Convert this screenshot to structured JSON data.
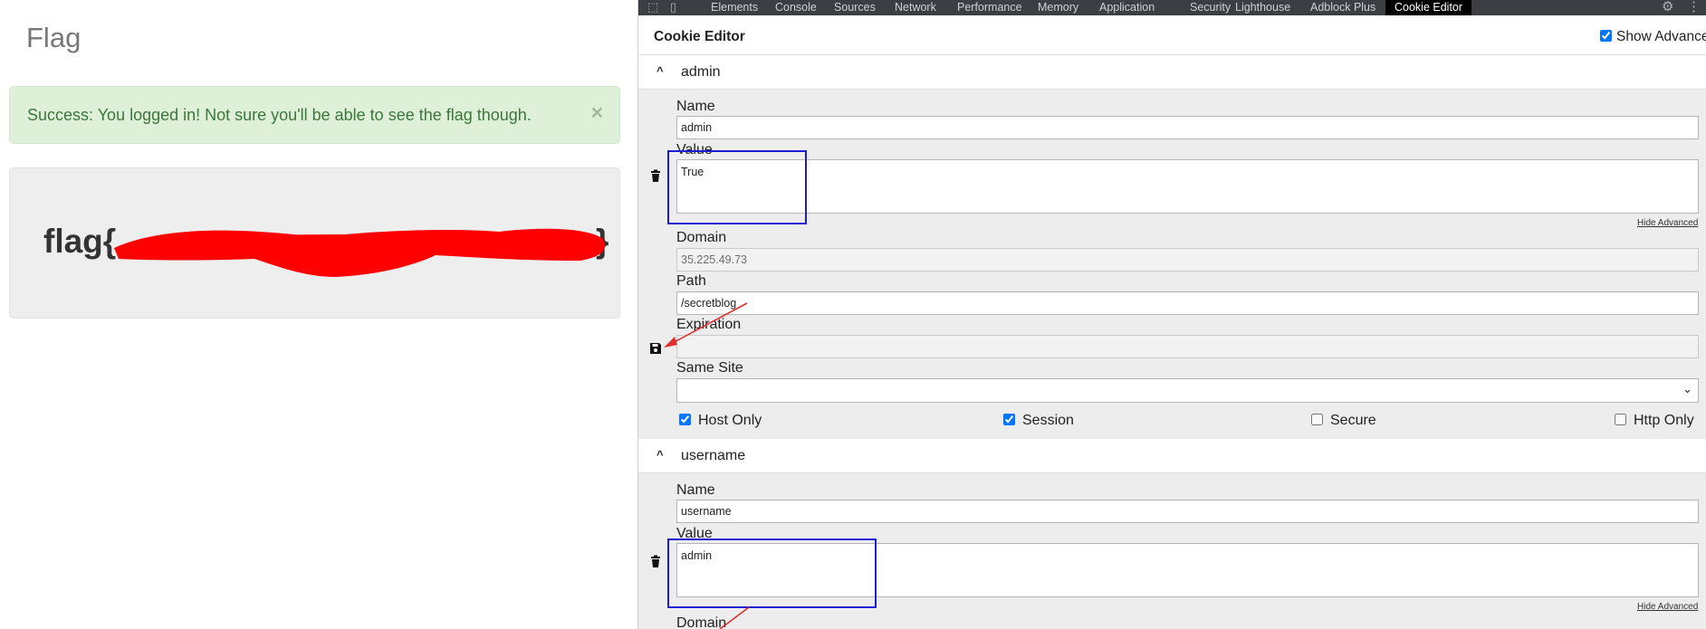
{
  "page": {
    "heading": "Flag",
    "alert_text": "Success: You logged in! Not sure you'll be able to see the flag though.",
    "alert_close": "×",
    "flag_prefix": "flag{",
    "flag_suffix": "}"
  },
  "devtools": {
    "tabs": [
      "Elements",
      "Console",
      "Sources",
      "Network",
      "Performance",
      "Memory",
      "Application",
      "Security",
      "Lighthouse",
      "Adblock Plus",
      "Cookie Editor"
    ],
    "active_tab": "Cookie Editor",
    "panel_title": "Cookie Editor",
    "show_advanced_label": "Show Advanced",
    "show_advanced_checked": true
  },
  "cookies": [
    {
      "name": "admin",
      "fields": {
        "name_label": "Name",
        "name_value": "admin",
        "value_label": "Value",
        "value_value": "True",
        "hide_advanced": "Hide Advanced",
        "domain_label": "Domain",
        "domain_value": "35.225.49.73",
        "path_label": "Path",
        "path_value": "/secretblog",
        "expiration_label": "Expiration",
        "expiration_value": "",
        "same_site_label": "Same Site",
        "same_site_value": ""
      },
      "flags": {
        "host_only_label": "Host Only",
        "host_only": true,
        "session_label": "Session",
        "session": true,
        "secure_label": "Secure",
        "secure": false,
        "http_only_label": "Http Only",
        "http_only": false
      }
    },
    {
      "name": "username",
      "fields": {
        "name_label": "Name",
        "name_value": "username",
        "value_label": "Value",
        "value_value": "admin",
        "hide_advanced": "Hide Advanced",
        "domain_label": "Domain"
      }
    }
  ],
  "icons": {
    "caret": "chevron-up-icon",
    "delete": "trash-icon",
    "save": "floppy-disk-icon",
    "select": "chevron-down-icon",
    "settings": "gear-icon",
    "more": "kebab-menu-icon"
  },
  "colors": {
    "alert_bg": "#dff0d8",
    "alert_text": "#3c763d",
    "redaction": "#ff0000",
    "highlight_box": "#1b1bd6",
    "annotation_arrow": "#e03030",
    "devtools_tabbar": "#3b3e43"
  }
}
